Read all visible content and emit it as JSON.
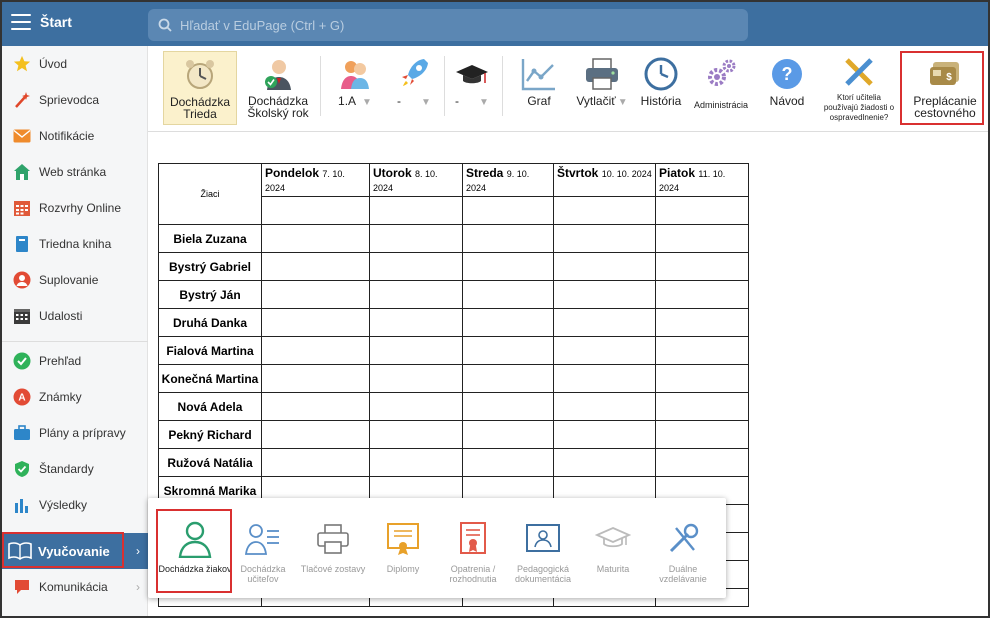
{
  "topbar": {
    "start_label": "Štart",
    "search_placeholder": "Hľadať v EduPage (Ctrl + G)"
  },
  "sidebar": {
    "items": [
      {
        "label": "Úvod",
        "icon": "star-icon"
      },
      {
        "label": "Sprievodca",
        "icon": "wand-icon"
      },
      {
        "label": "Notifikácie",
        "icon": "envelope-icon"
      },
      {
        "label": "Web stránka",
        "icon": "home-icon"
      },
      {
        "label": "Rozvrhy Online",
        "icon": "calendar-grid-icon"
      },
      {
        "label": "Triedna kniha",
        "icon": "book-icon"
      },
      {
        "label": "Suplovanie",
        "icon": "person-icon"
      },
      {
        "label": "Udalosti",
        "icon": "calendar-icon"
      },
      {
        "label": "Prehľad",
        "icon": "check-circle-icon"
      },
      {
        "label": "Známky",
        "icon": "grade-icon"
      },
      {
        "label": "Plány a prípravy",
        "icon": "briefcase-icon"
      },
      {
        "label": "Štandardy",
        "icon": "shield-icon"
      },
      {
        "label": "Výsledky",
        "icon": "bar-chart-icon"
      },
      {
        "label": "Vyučovanie",
        "icon": "open-book-icon"
      },
      {
        "label": "Komunikácia",
        "icon": "chat-icon"
      }
    ]
  },
  "toolbar": {
    "attendance_class": "Dochádzka Trieda",
    "attendance_year": "Dochádzka Školský rok",
    "class_select": "1.A",
    "select2": "-",
    "select3": "-",
    "graph": "Graf",
    "print": "Vytlačiť",
    "history": "História",
    "admin": "Administrácia",
    "help": "Návod",
    "teachers_question": "Ktorí učitelia používajú žiadosti o ospravedlnenie?",
    "travel": "Preplácanie cestovného"
  },
  "table": {
    "students_header": "Žiaci",
    "days": [
      {
        "name": "Pondelok",
        "date": "7. 10. 2024"
      },
      {
        "name": "Utorok",
        "date": "8. 10. 2024"
      },
      {
        "name": "Streda",
        "date": "9. 10. 2024"
      },
      {
        "name": "Štvrtok",
        "date": "10. 10. 2024"
      },
      {
        "name": "Piatok",
        "date": "11. 10. 2024"
      }
    ],
    "students": [
      "Biela Zuzana",
      "Bystrý Gabriel",
      "Bystrý Ján",
      "Druhá Danka",
      "Fialová Martina",
      "Konečná Martina",
      "Nová Adela",
      "Pekný Richard",
      "Ružová Natália",
      "Skromná Marika"
    ]
  },
  "popup": {
    "items": [
      {
        "label": "Dochádzka žiakov",
        "icon": "student-icon"
      },
      {
        "label": "Dochádzka učiteľov",
        "icon": "teacher-list-icon"
      },
      {
        "label": "Tlačové zostavy",
        "icon": "printer-icon"
      },
      {
        "label": "Diplomy",
        "icon": "diploma-icon"
      },
      {
        "label": "Opatrenia / rozhodnutia",
        "icon": "certificate-icon"
      },
      {
        "label": "Pedagogická dokumentácia",
        "icon": "id-card-icon"
      },
      {
        "label": "Maturita",
        "icon": "graduation-cap-icon"
      },
      {
        "label": "Duálne vzdelávanie",
        "icon": "tools-icon"
      }
    ]
  },
  "colors": {
    "topbar": "#3d6fa0",
    "active_toolbar": "#fbf1cc",
    "highlight": "#d93030"
  }
}
